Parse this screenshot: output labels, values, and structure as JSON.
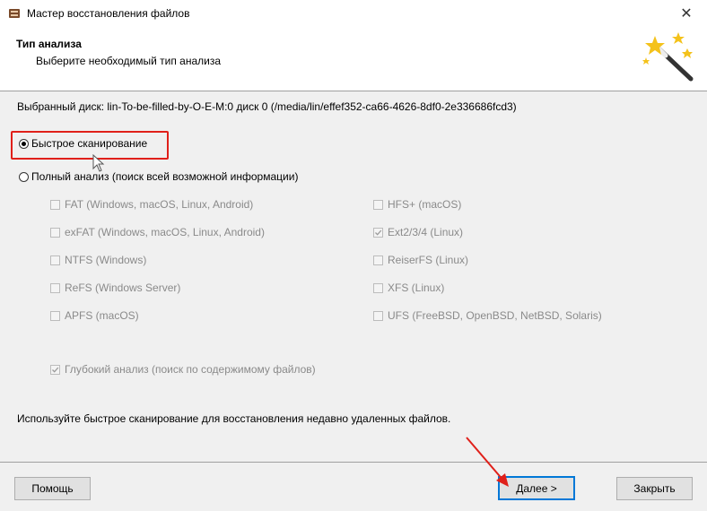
{
  "window": {
    "title": "Мастер восстановления файлов",
    "close_glyph": "✕"
  },
  "header": {
    "title": "Тип анализа",
    "subtitle": "Выберите необходимый тип анализа",
    "icon": "magic-wand-icon"
  },
  "disk_label": "Выбранный диск: lin-To-be-filled-by-O-E-M:0 диск 0 (/media/lin/effef352-ca66-4626-8df0-2e336686fcd3)",
  "options": {
    "quick_scan": {
      "label": "Быстрое сканирование",
      "selected": true
    },
    "full_analysis": {
      "label": "Полный анализ (поиск всей возможной информации)",
      "selected": false
    }
  },
  "filesystems": {
    "left": [
      {
        "label": "FAT (Windows, macOS, Linux, Android)",
        "checked": false
      },
      {
        "label": "exFAT (Windows, macOS, Linux, Android)",
        "checked": false
      },
      {
        "label": "NTFS (Windows)",
        "checked": false
      },
      {
        "label": "ReFS (Windows Server)",
        "checked": false
      },
      {
        "label": "APFS (macOS)",
        "checked": false
      }
    ],
    "right": [
      {
        "label": "HFS+ (macOS)",
        "checked": false
      },
      {
        "label": "Ext2/3/4 (Linux)",
        "checked": true
      },
      {
        "label": "ReiserFS (Linux)",
        "checked": false
      },
      {
        "label": "XFS (Linux)",
        "checked": false
      },
      {
        "label": "UFS (FreeBSD, OpenBSD, NetBSD, Solaris)",
        "checked": false
      }
    ]
  },
  "deep_analysis": {
    "label": "Глубокий анализ (поиск по содержимому файлов)",
    "checked": true
  },
  "footer_hint": "Используйте быстрое сканирование для восстановления недавно удаленных файлов.",
  "buttons": {
    "help": "Помощь",
    "next": "Далее >",
    "close": "Закрыть"
  },
  "colors": {
    "annotation_red": "#e0201a",
    "focus_blue": "#0078d7"
  }
}
